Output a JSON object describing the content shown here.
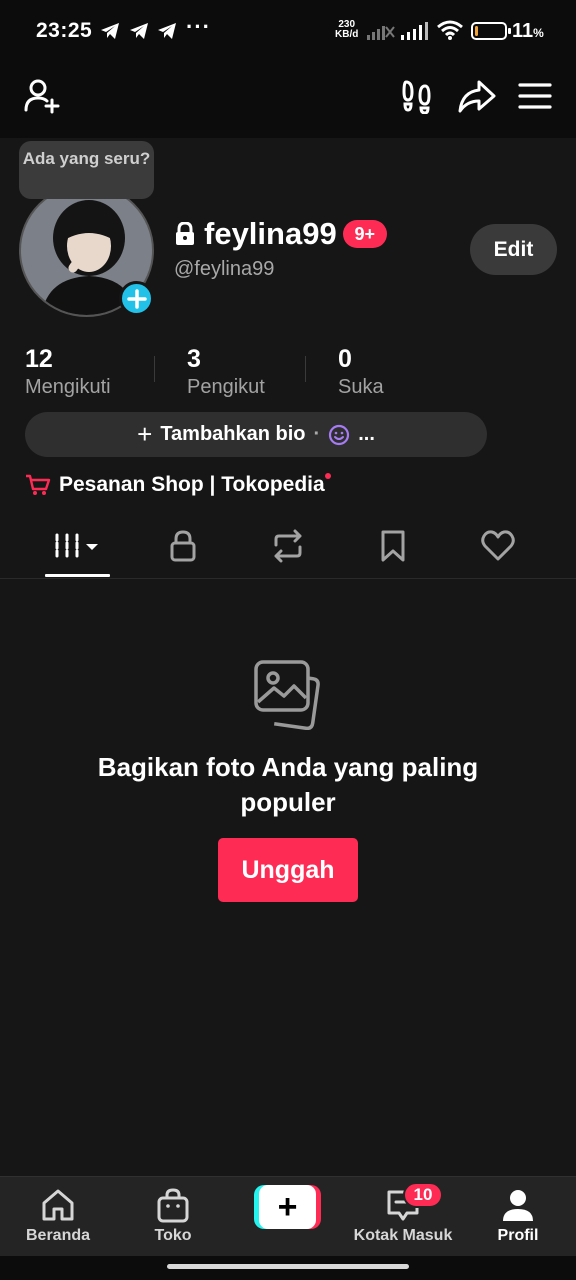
{
  "status_bar": {
    "time": "23:25",
    "dots": "···",
    "net_speed_value": "230",
    "net_speed_unit": "KB/d",
    "battery_pct": "11",
    "battery_unit": "%",
    "battery_level": 0.11,
    "battery_color": "#f2a43a"
  },
  "top_bar": {
    "icons": [
      "add-friend-icon",
      "footprints-icon",
      "share-icon",
      "menu-icon"
    ]
  },
  "profile": {
    "tooltip": "Ada yang seru?",
    "username": "feylina99",
    "notif_badge": "9+",
    "handle": "@feylina99",
    "edit_label": "Edit"
  },
  "stats": [
    {
      "value": "12",
      "label": "Mengikuti"
    },
    {
      "value": "3",
      "label": "Pengikut"
    },
    {
      "value": "0",
      "label": "Suka"
    }
  ],
  "bio": {
    "plus": "+",
    "label": "Tambahkan bio",
    "separator": "·",
    "ellipsis": "..."
  },
  "shop": {
    "label": "Pesanan Shop | Tokopedia"
  },
  "tabs": [
    "videos-grid-icon",
    "lock-icon",
    "repost-icon",
    "bookmark-icon",
    "heart-icon"
  ],
  "empty_state": {
    "title": "Bagikan foto Anda yang paling populer",
    "button": "Unggah"
  },
  "bottom_nav": {
    "items": [
      {
        "label": "Beranda"
      },
      {
        "label": "Toko"
      },
      {
        "label": "+"
      },
      {
        "label": "Kotak Masuk",
        "badge": "10"
      },
      {
        "label": "Profil"
      }
    ]
  },
  "colors": {
    "accent": "#fe2c55",
    "cyan": "#25f4ee",
    "background": "#161616"
  }
}
